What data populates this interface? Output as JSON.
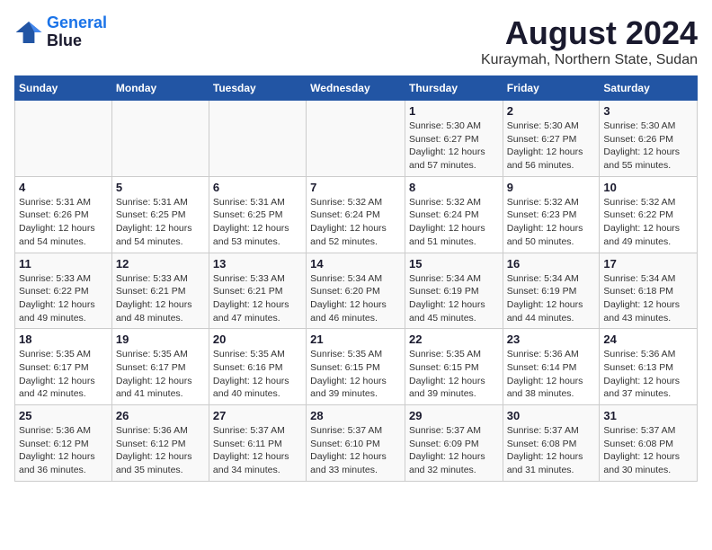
{
  "logo": {
    "line1": "General",
    "line2": "Blue"
  },
  "title": "August 2024",
  "subtitle": "Kuraymah, Northern State, Sudan",
  "days_of_week": [
    "Sunday",
    "Monday",
    "Tuesday",
    "Wednesday",
    "Thursday",
    "Friday",
    "Saturday"
  ],
  "weeks": [
    [
      {
        "day": "",
        "sunrise": "",
        "sunset": "",
        "daylight": ""
      },
      {
        "day": "",
        "sunrise": "",
        "sunset": "",
        "daylight": ""
      },
      {
        "day": "",
        "sunrise": "",
        "sunset": "",
        "daylight": ""
      },
      {
        "day": "",
        "sunrise": "",
        "sunset": "",
        "daylight": ""
      },
      {
        "day": "1",
        "sunrise": "Sunrise: 5:30 AM",
        "sunset": "Sunset: 6:27 PM",
        "daylight": "Daylight: 12 hours and 57 minutes."
      },
      {
        "day": "2",
        "sunrise": "Sunrise: 5:30 AM",
        "sunset": "Sunset: 6:27 PM",
        "daylight": "Daylight: 12 hours and 56 minutes."
      },
      {
        "day": "3",
        "sunrise": "Sunrise: 5:30 AM",
        "sunset": "Sunset: 6:26 PM",
        "daylight": "Daylight: 12 hours and 55 minutes."
      }
    ],
    [
      {
        "day": "4",
        "sunrise": "Sunrise: 5:31 AM",
        "sunset": "Sunset: 6:26 PM",
        "daylight": "Daylight: 12 hours and 54 minutes."
      },
      {
        "day": "5",
        "sunrise": "Sunrise: 5:31 AM",
        "sunset": "Sunset: 6:25 PM",
        "daylight": "Daylight: 12 hours and 54 minutes."
      },
      {
        "day": "6",
        "sunrise": "Sunrise: 5:31 AM",
        "sunset": "Sunset: 6:25 PM",
        "daylight": "Daylight: 12 hours and 53 minutes."
      },
      {
        "day": "7",
        "sunrise": "Sunrise: 5:32 AM",
        "sunset": "Sunset: 6:24 PM",
        "daylight": "Daylight: 12 hours and 52 minutes."
      },
      {
        "day": "8",
        "sunrise": "Sunrise: 5:32 AM",
        "sunset": "Sunset: 6:24 PM",
        "daylight": "Daylight: 12 hours and 51 minutes."
      },
      {
        "day": "9",
        "sunrise": "Sunrise: 5:32 AM",
        "sunset": "Sunset: 6:23 PM",
        "daylight": "Daylight: 12 hours and 50 minutes."
      },
      {
        "day": "10",
        "sunrise": "Sunrise: 5:32 AM",
        "sunset": "Sunset: 6:22 PM",
        "daylight": "Daylight: 12 hours and 49 minutes."
      }
    ],
    [
      {
        "day": "11",
        "sunrise": "Sunrise: 5:33 AM",
        "sunset": "Sunset: 6:22 PM",
        "daylight": "Daylight: 12 hours and 49 minutes."
      },
      {
        "day": "12",
        "sunrise": "Sunrise: 5:33 AM",
        "sunset": "Sunset: 6:21 PM",
        "daylight": "Daylight: 12 hours and 48 minutes."
      },
      {
        "day": "13",
        "sunrise": "Sunrise: 5:33 AM",
        "sunset": "Sunset: 6:21 PM",
        "daylight": "Daylight: 12 hours and 47 minutes."
      },
      {
        "day": "14",
        "sunrise": "Sunrise: 5:34 AM",
        "sunset": "Sunset: 6:20 PM",
        "daylight": "Daylight: 12 hours and 46 minutes."
      },
      {
        "day": "15",
        "sunrise": "Sunrise: 5:34 AM",
        "sunset": "Sunset: 6:19 PM",
        "daylight": "Daylight: 12 hours and 45 minutes."
      },
      {
        "day": "16",
        "sunrise": "Sunrise: 5:34 AM",
        "sunset": "Sunset: 6:19 PM",
        "daylight": "Daylight: 12 hours and 44 minutes."
      },
      {
        "day": "17",
        "sunrise": "Sunrise: 5:34 AM",
        "sunset": "Sunset: 6:18 PM",
        "daylight": "Daylight: 12 hours and 43 minutes."
      }
    ],
    [
      {
        "day": "18",
        "sunrise": "Sunrise: 5:35 AM",
        "sunset": "Sunset: 6:17 PM",
        "daylight": "Daylight: 12 hours and 42 minutes."
      },
      {
        "day": "19",
        "sunrise": "Sunrise: 5:35 AM",
        "sunset": "Sunset: 6:17 PM",
        "daylight": "Daylight: 12 hours and 41 minutes."
      },
      {
        "day": "20",
        "sunrise": "Sunrise: 5:35 AM",
        "sunset": "Sunset: 6:16 PM",
        "daylight": "Daylight: 12 hours and 40 minutes."
      },
      {
        "day": "21",
        "sunrise": "Sunrise: 5:35 AM",
        "sunset": "Sunset: 6:15 PM",
        "daylight": "Daylight: 12 hours and 39 minutes."
      },
      {
        "day": "22",
        "sunrise": "Sunrise: 5:35 AM",
        "sunset": "Sunset: 6:15 PM",
        "daylight": "Daylight: 12 hours and 39 minutes."
      },
      {
        "day": "23",
        "sunrise": "Sunrise: 5:36 AM",
        "sunset": "Sunset: 6:14 PM",
        "daylight": "Daylight: 12 hours and 38 minutes."
      },
      {
        "day": "24",
        "sunrise": "Sunrise: 5:36 AM",
        "sunset": "Sunset: 6:13 PM",
        "daylight": "Daylight: 12 hours and 37 minutes."
      }
    ],
    [
      {
        "day": "25",
        "sunrise": "Sunrise: 5:36 AM",
        "sunset": "Sunset: 6:12 PM",
        "daylight": "Daylight: 12 hours and 36 minutes."
      },
      {
        "day": "26",
        "sunrise": "Sunrise: 5:36 AM",
        "sunset": "Sunset: 6:12 PM",
        "daylight": "Daylight: 12 hours and 35 minutes."
      },
      {
        "day": "27",
        "sunrise": "Sunrise: 5:37 AM",
        "sunset": "Sunset: 6:11 PM",
        "daylight": "Daylight: 12 hours and 34 minutes."
      },
      {
        "day": "28",
        "sunrise": "Sunrise: 5:37 AM",
        "sunset": "Sunset: 6:10 PM",
        "daylight": "Daylight: 12 hours and 33 minutes."
      },
      {
        "day": "29",
        "sunrise": "Sunrise: 5:37 AM",
        "sunset": "Sunset: 6:09 PM",
        "daylight": "Daylight: 12 hours and 32 minutes."
      },
      {
        "day": "30",
        "sunrise": "Sunrise: 5:37 AM",
        "sunset": "Sunset: 6:08 PM",
        "daylight": "Daylight: 12 hours and 31 minutes."
      },
      {
        "day": "31",
        "sunrise": "Sunrise: 5:37 AM",
        "sunset": "Sunset: 6:08 PM",
        "daylight": "Daylight: 12 hours and 30 minutes."
      }
    ]
  ]
}
